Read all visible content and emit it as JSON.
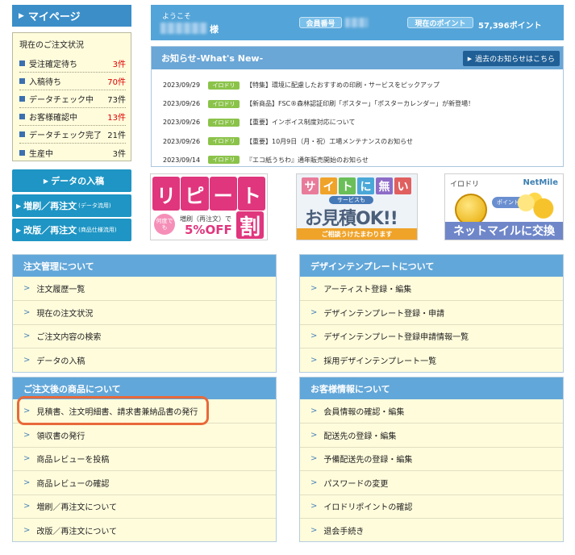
{
  "mypage": {
    "title": "マイページ",
    "status_title": "現在のご注文状況",
    "status_items": [
      {
        "label": "受注確定待ち",
        "count": "3件",
        "color": "#e00000"
      },
      {
        "label": "入稿待ち",
        "count": "70件",
        "color": "#e00000"
      },
      {
        "label": "データチェック中",
        "count": "73件",
        "color": "#222222"
      },
      {
        "label": "お客様確認中",
        "count": "13件",
        "color": "#e00000"
      },
      {
        "label": "データチェック完了",
        "count": "21件",
        "color": "#222222"
      },
      {
        "label": "生産中",
        "count": "3件",
        "color": "#222222"
      }
    ],
    "buttons": {
      "upload": "データの入稿",
      "reprint_data": "増刷／再注文",
      "reprint_data_sub": "(データ流用)",
      "revise": "改版／再注文",
      "revise_sub": "(商品仕様流用)"
    }
  },
  "welcome": {
    "greeting": "ようこそ",
    "honorific": "様",
    "member_label": "会員番号",
    "points_label": "現在のポイント",
    "points_value": "57,396ポイント"
  },
  "news": {
    "title": "お知らせ-What's New-",
    "past_link": "過去のお知らせはこちら",
    "tag": "イロドリ",
    "items": [
      {
        "date": "2023/09/29",
        "text": "【特集】環境に配慮したおすすめの印刷・サービスをピックアップ"
      },
      {
        "date": "2023/09/26",
        "text": "【新商品】FSC®森林認証印刷「ポスター」「ポスターカレンダー」が新登場！"
      },
      {
        "date": "2023/09/26",
        "text": "【重要】インボイス制度対応について"
      },
      {
        "date": "2023/09/26",
        "text": "【重要】10月9日（月・祝）工場メンテナンスのお知らせ"
      },
      {
        "date": "2023/09/14",
        "text": "『エコ紙うちわ』通年販売開始のお知らせ"
      }
    ]
  },
  "banners": {
    "repeat": {
      "headline_chars": [
        "リ",
        "ピ",
        "ー",
        "ト"
      ],
      "badge": "何度でも",
      "sub": "増刷（再注文）で",
      "off": "5%OFF",
      "wari": "割"
    },
    "estimate": {
      "top_chars": [
        "サ",
        "イ",
        "ト",
        "に",
        "無",
        "い"
      ],
      "top_colors": [
        "#e97b9a",
        "#f0a329",
        "#6bbf59",
        "#4aa8d8",
        "#8d6cc7",
        "#e06060"
      ],
      "sub": "サービスも",
      "main": "お見積OK!!",
      "bottom": "ご相談うけたまわります"
    },
    "netmile": {
      "logo_left": "イロドリ",
      "logo_right": "NetMile",
      "arrow": "ポイントを",
      "bottom": "ネットマイルに交換"
    }
  },
  "panels": {
    "order": {
      "title": "注文管理について",
      "items": [
        "注文履歴一覧",
        "現在の注文状況",
        "ご注文内容の検索",
        "データの入稿"
      ]
    },
    "design": {
      "title": "デザインテンプレートについて",
      "items": [
        "アーティスト登録・編集",
        "デザインテンプレート登録・申請",
        "デザインテンプレート登録申請情報一覧",
        "採用デザインテンプレート一覧"
      ]
    },
    "after": {
      "title": "ご注文後の商品について",
      "items": [
        "見積書、注文明細書、請求書兼納品書の発行",
        "領収書の発行",
        "商品レビューを投稿",
        "商品レビューの確認",
        "増刷／再注文について",
        "改版／再注文について"
      ]
    },
    "customer": {
      "title": "お客様情報について",
      "items": [
        "会員情報の確認・編集",
        "配送先の登録・編集",
        "予備配送先の登録・編集",
        "パスワードの変更",
        "イロドリポイントの確認",
        "退会手続き"
      ]
    }
  },
  "colors": {
    "header_blue": "#3b8ec8",
    "panel_bg": "#fffcdc",
    "accent_red": "#e00000",
    "highlight": "#e8693a"
  }
}
